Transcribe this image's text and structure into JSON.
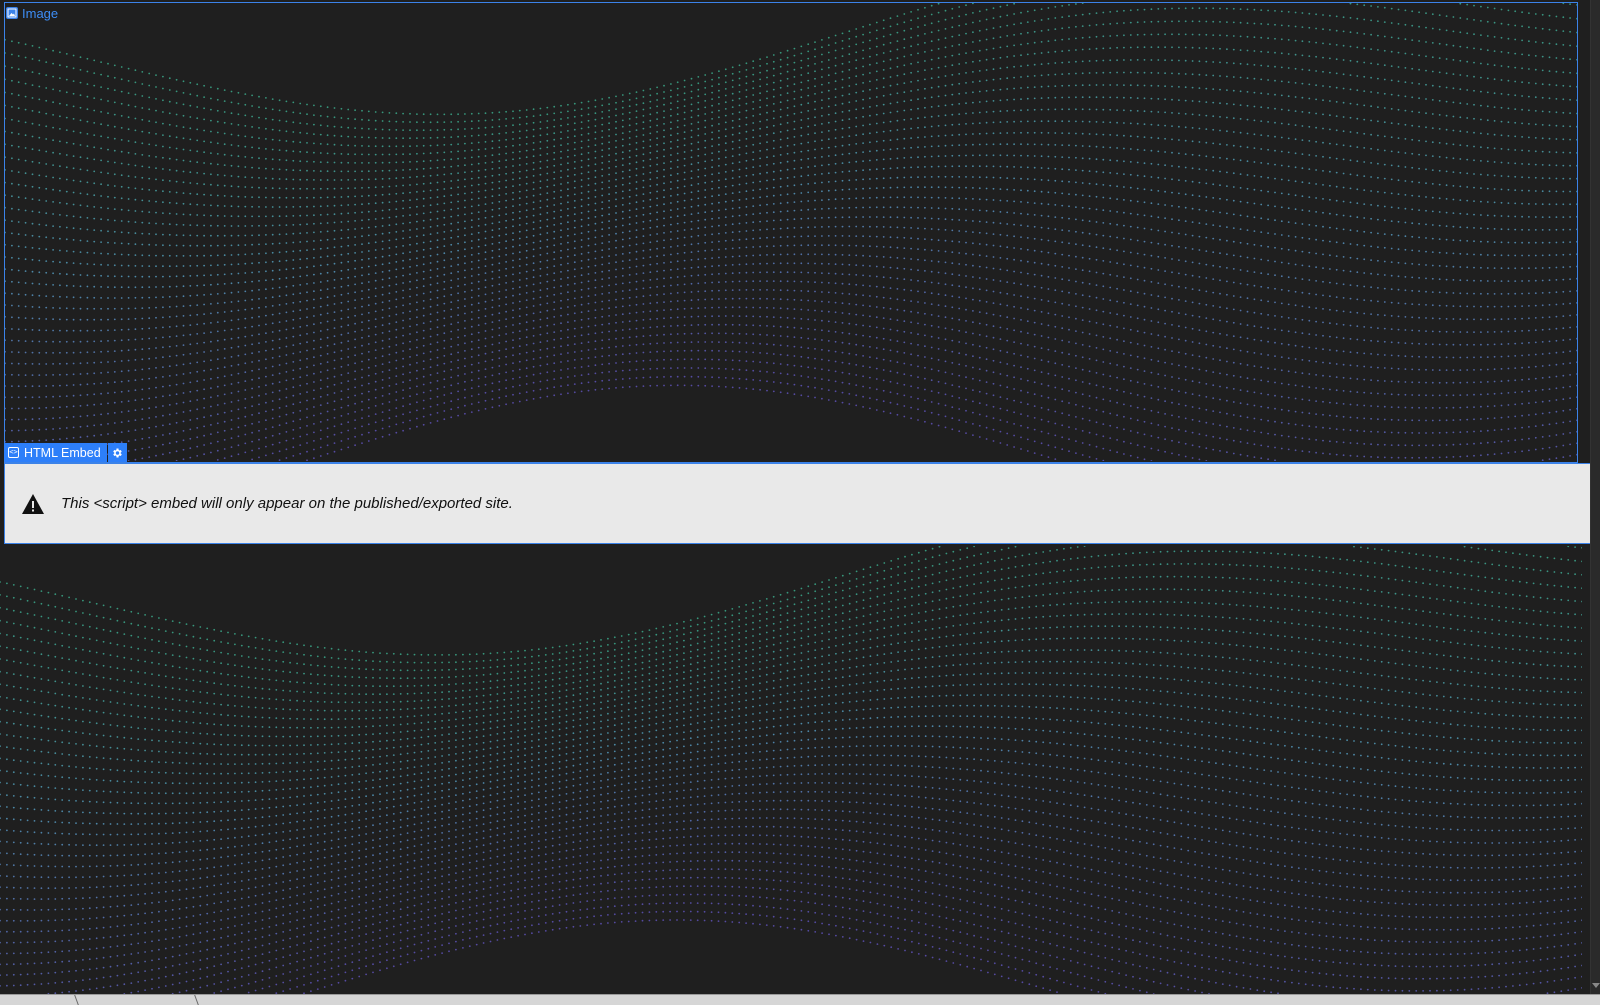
{
  "image_element": {
    "label": "Image",
    "icon": "image-icon"
  },
  "embed_element": {
    "label": "HTML Embed",
    "icon": "code-icon",
    "settings_icon": "gear-icon"
  },
  "notice": {
    "text": "This <script> embed will only appear on the published/exported site.",
    "icon": "warning-icon"
  },
  "colors": {
    "canvas_bg": "#1f1f1f",
    "selection_blue": "#3b82e8",
    "tag_blue": "#2d7ff9",
    "dot_teal": "#3fbf9b",
    "dot_violet": "#6b5bd6",
    "notice_bg": "#e9e9e9"
  }
}
